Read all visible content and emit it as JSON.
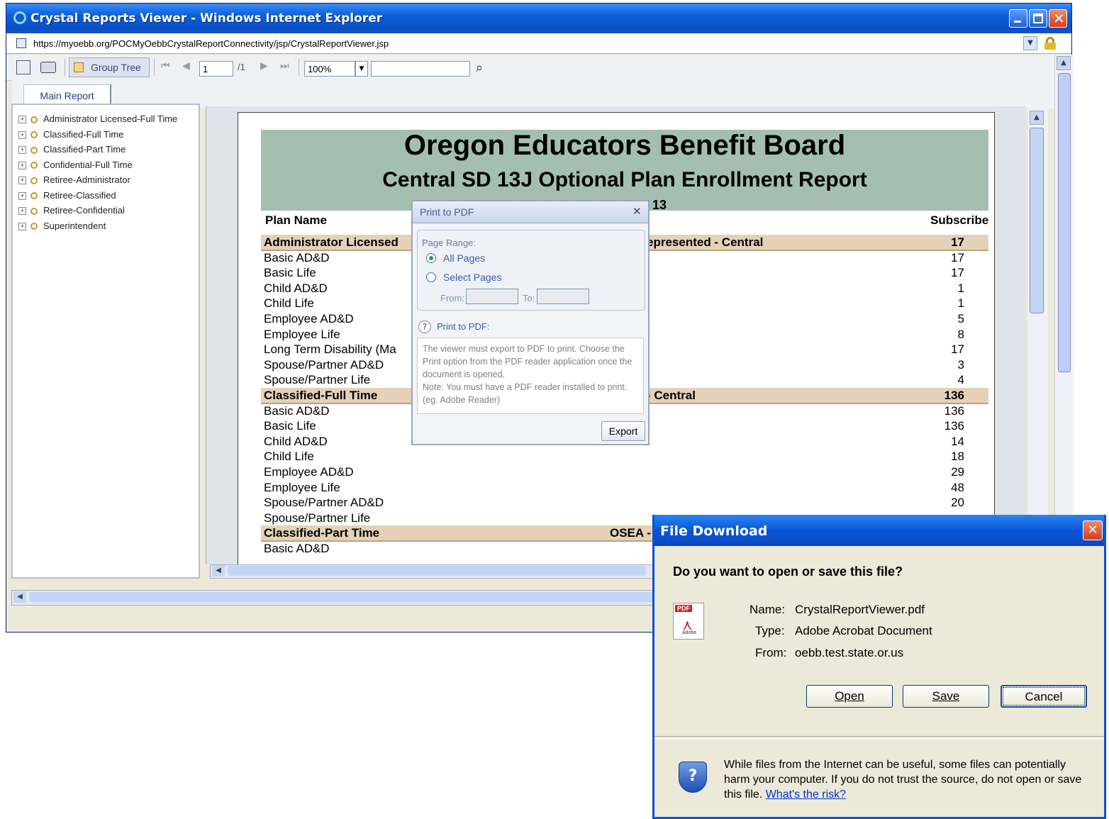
{
  "ie": {
    "title": "Crystal Reports Viewer - Windows Internet Explorer",
    "url": "https://myoebb.org/POCMyOebbCrystalReportConnectivity/jsp/CrystalReportViewer.jsp"
  },
  "toolbar": {
    "group_tree": "Group Tree",
    "page_value": "1",
    "page_total": "/1",
    "zoom": "100%"
  },
  "tabs": {
    "main": "Main Report"
  },
  "tree": {
    "items": [
      "Administrator Licensed-Full Time",
      "Classified-Full Time",
      "Classified-Part Time",
      "Confidential-Full Time",
      "Retiree-Administrator",
      "Retiree-Classified",
      "Retiree-Confidential",
      "Superintendent"
    ]
  },
  "report": {
    "title": "Oregon Educators Benefit Board",
    "subtitle": "Central SD 13J Optional Plan Enrollment Report",
    "sub_fragment": "13",
    "col_plan": "Plan Name",
    "col_sub": "Subscribe",
    "rows": [
      {
        "name": "Administrator Licensed",
        "mid": "epresented - Central",
        "value": "17",
        "group": true
      },
      {
        "name": "Basic AD&D",
        "mid": "",
        "value": "17"
      },
      {
        "name": "Basic Life",
        "mid": "",
        "value": "17"
      },
      {
        "name": "Child AD&D",
        "mid": "",
        "value": "1"
      },
      {
        "name": "Child Life",
        "mid": "",
        "value": "1"
      },
      {
        "name": "Employee AD&D",
        "mid": "",
        "value": "5"
      },
      {
        "name": "Employee Life",
        "mid": "",
        "value": "8"
      },
      {
        "name": "Long Term Disability (Ma",
        "mid": "",
        "value": "17"
      },
      {
        "name": "Spouse/Partner AD&D",
        "mid": "",
        "value": "3"
      },
      {
        "name": "Spouse/Partner Life",
        "mid": "",
        "value": "4"
      },
      {
        "name": "Classified-Full Time",
        "mid": "- Central",
        "value": "136",
        "group": true
      },
      {
        "name": "Basic AD&D",
        "mid": "",
        "value": "136"
      },
      {
        "name": "Basic Life",
        "mid": "",
        "value": "136"
      },
      {
        "name": "Child AD&D",
        "mid": "",
        "value": "14"
      },
      {
        "name": "Child Life",
        "mid": "",
        "value": "18"
      },
      {
        "name": "Employee AD&D",
        "mid": "",
        "value": "29"
      },
      {
        "name": "Employee Life",
        "mid": "",
        "value": "48"
      },
      {
        "name": "Spouse/Partner AD&D",
        "mid": "",
        "value": "20"
      },
      {
        "name": "Spouse/Partner Life",
        "mid": "",
        "value": ""
      },
      {
        "name": "Classified-Part Time",
        "mid": "OSEA -",
        "value": "",
        "group": true
      },
      {
        "name": "Basic AD&D",
        "mid": "",
        "value": ""
      }
    ]
  },
  "pdf_dialog": {
    "title": "Print to PDF",
    "page_range": "Page Range:",
    "all_pages": "All Pages",
    "select_pages": "Select Pages",
    "from": "From:",
    "to": "To:",
    "help_label": "Print to PDF:",
    "help_text_1": "The viewer must export to PDF to print. Choose the Print option from the PDF reader application once the document is opened.",
    "help_text_2": "Note: You must have a PDF reader installed to print. (eg. Adobe Reader)",
    "export": "Export"
  },
  "file_download": {
    "title": "File Download",
    "question": "Do you want to open or save this file?",
    "name_label": "Name:",
    "name_value": "CrystalReportViewer.pdf",
    "type_label": "Type:",
    "type_value": "Adobe Acrobat Document",
    "from_label": "From:",
    "from_value": "oebb.test.state.or.us",
    "open": "Open",
    "save": "Save",
    "cancel": "Cancel",
    "warning": "While files from the Internet can be useful, some files can potentially harm your computer. If you do not trust the source, do not open or save this file.",
    "risk_link": "What's the risk?",
    "pdf_badge": "PDF",
    "adobe_badge": "Adobe"
  }
}
